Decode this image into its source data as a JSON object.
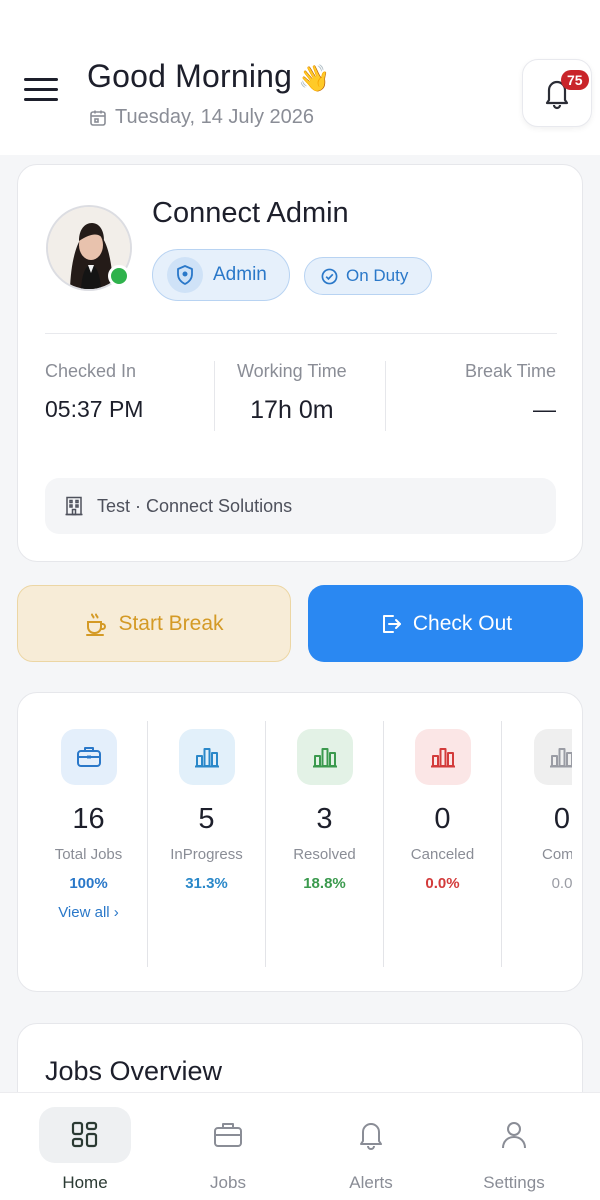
{
  "header": {
    "greeting": "Good Morning",
    "greeting_emoji": "👋",
    "date": "Tuesday, 14 July 2026",
    "notification_count": "75"
  },
  "profile": {
    "name": "Connect Admin",
    "role": "Admin",
    "status": "On Duty",
    "online_color": "#2fb24c",
    "stats": {
      "checked_in_label": "Checked In",
      "checked_in_value": "05:37 PM",
      "working_time_label": "Working Time",
      "working_time_value": "17h 0m",
      "break_time_label": "Break Time",
      "break_time_value": "—"
    },
    "company": "Test · Connect Solutions"
  },
  "actions": {
    "start_break": "Start Break",
    "check_out": "Check Out"
  },
  "job_stats": [
    {
      "count": "16",
      "label": "Total Jobs",
      "percent": "100%",
      "color": "#2a78c9",
      "tile_bg": "#e4effb",
      "icon": "briefcase-icon"
    },
    {
      "count": "5",
      "label": "InProgress",
      "percent": "31.3%",
      "color": "#2a88c9",
      "tile_bg": "#e2f0fa",
      "icon": "bar-chart-icon"
    },
    {
      "count": "3",
      "label": "Resolved",
      "percent": "18.8%",
      "color": "#3b9a4e",
      "tile_bg": "#e3f2e6",
      "icon": "bar-chart-icon"
    },
    {
      "count": "0",
      "label": "Canceled",
      "percent": "0.0%",
      "color": "#d33b3b",
      "tile_bg": "#fbe6e6",
      "icon": "bar-chart-icon"
    },
    {
      "count": "0",
      "label": "Comp",
      "percent": "0.0",
      "color": "#9a9ca4",
      "tile_bg": "#efefef",
      "icon": "bar-chart-icon"
    }
  ],
  "view_all": "View all ›",
  "overview": {
    "title": "Jobs Overview"
  },
  "nav": {
    "home": "Home",
    "jobs": "Jobs",
    "alerts": "Alerts",
    "settings": "Settings"
  }
}
